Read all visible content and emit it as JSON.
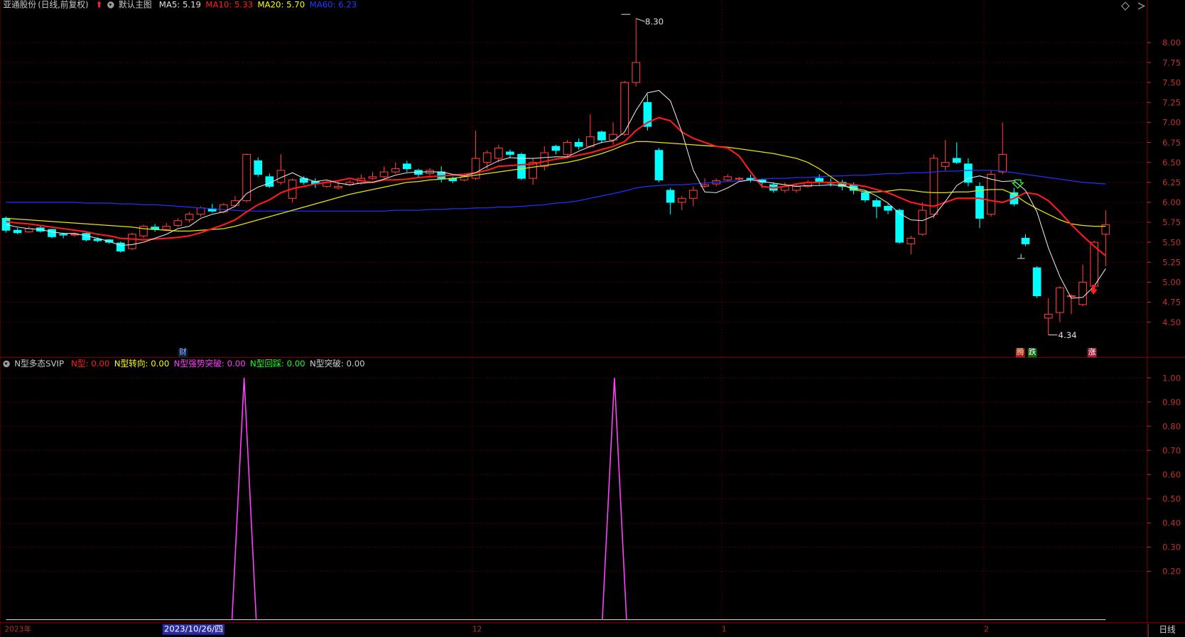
{
  "main_panel": {
    "stock_name": "亚通股份",
    "period_label": "(日线,前复权)",
    "indicator_name": "默认主图",
    "ma_labels": [
      {
        "text": "MA5: 5.19",
        "color": "#e0e0e0"
      },
      {
        "text": "MA10: 5.33",
        "color": "#ff2020"
      },
      {
        "text": "MA20: 5.70",
        "color": "#ffff00"
      },
      {
        "text": "MA60: 6.23",
        "color": "#1f3cff"
      }
    ],
    "high_label": "8.30",
    "low_label": "4.34",
    "tags": {
      "finance": "财",
      "rise_fall_1": "腾",
      "rise_fall_2": "跌",
      "rise": "涨"
    }
  },
  "sub_panel": {
    "title": "N型多态SVIP",
    "items": [
      {
        "text": "N型: 0.00",
        "color": "#ff2020"
      },
      {
        "text": "N型转向: 0.00",
        "color": "#ffff00"
      },
      {
        "text": "N型强势突破: 0.00",
        "color": "#ff40ff"
      },
      {
        "text": "N型回踩: 0.00",
        "color": "#20ff20"
      },
      {
        "text": "N型突破: 0.00",
        "color": "#d0d0d0"
      }
    ]
  },
  "x_axis": {
    "labels": [
      "2023年",
      "12",
      "1",
      "2"
    ],
    "highlighted_date": "2023/10/26/四",
    "period_tab": "日线"
  },
  "colors": {
    "up": "#ff3b3b",
    "down": "#00ffff",
    "ma5": "#e6e6e6",
    "ma10": "#ff1a1a",
    "ma20": "#e6e600",
    "ma60": "#2030ff",
    "indicator": "#ff40ff",
    "grid": "#7a0000"
  },
  "chart_data": [
    {
      "type": "candlestick",
      "ylim": [
        4.2,
        8.4
      ],
      "yticks": [
        "4.50",
        "4.75",
        "5.00",
        "5.25",
        "5.50",
        "5.75",
        "6.00",
        "6.25",
        "6.50",
        "6.75",
        "7.00",
        "7.25",
        "7.50",
        "7.75",
        "8.00"
      ],
      "candles": [
        [
          5.8,
          5.65,
          5.82,
          5.62
        ],
        [
          5.65,
          5.62,
          5.68,
          5.6
        ],
        [
          5.63,
          5.67,
          5.7,
          5.62
        ],
        [
          5.68,
          5.64,
          5.7,
          5.62
        ],
        [
          5.66,
          5.57,
          5.67,
          5.55
        ],
        [
          5.6,
          5.59,
          5.62,
          5.55
        ],
        [
          5.59,
          5.6,
          5.62,
          5.57
        ],
        [
          5.61,
          5.53,
          5.62,
          5.51
        ],
        [
          5.54,
          5.52,
          5.56,
          5.5
        ],
        [
          5.53,
          5.5,
          5.54,
          5.48
        ],
        [
          5.49,
          5.39,
          5.51,
          5.37
        ],
        [
          5.42,
          5.6,
          5.62,
          5.4
        ],
        [
          5.58,
          5.7,
          5.72,
          5.55
        ],
        [
          5.69,
          5.66,
          5.73,
          5.63
        ],
        [
          5.66,
          5.7,
          5.74,
          5.64
        ],
        [
          5.71,
          5.77,
          5.8,
          5.69
        ],
        [
          5.78,
          5.85,
          5.88,
          5.75
        ],
        [
          5.85,
          5.93,
          5.95,
          5.82
        ],
        [
          5.92,
          5.89,
          5.98,
          5.87
        ],
        [
          5.88,
          5.97,
          5.99,
          5.86
        ],
        [
          5.96,
          6.02,
          6.08,
          5.94
        ],
        [
          6.02,
          6.6,
          6.61,
          6.0
        ],
        [
          6.52,
          6.35,
          6.56,
          6.32
        ],
        [
          6.32,
          6.2,
          6.36,
          6.18
        ],
        [
          6.25,
          6.4,
          6.6,
          6.22
        ],
        [
          6.05,
          6.28,
          6.3,
          6.0
        ],
        [
          6.3,
          6.25,
          6.33,
          6.22
        ],
        [
          6.26,
          6.23,
          6.3,
          6.18
        ],
        [
          6.2,
          6.25,
          6.28,
          6.18
        ],
        [
          6.18,
          6.2,
          6.26,
          6.16
        ],
        [
          6.22,
          6.25,
          6.28,
          6.2
        ],
        [
          6.24,
          6.3,
          6.35,
          6.22
        ],
        [
          6.3,
          6.32,
          6.38,
          6.28
        ],
        [
          6.32,
          6.38,
          6.45,
          6.3
        ],
        [
          6.38,
          6.42,
          6.5,
          6.36
        ],
        [
          6.48,
          6.42,
          6.52,
          6.38
        ],
        [
          6.4,
          6.35,
          6.42,
          6.3
        ],
        [
          6.36,
          6.4,
          6.43,
          6.33
        ],
        [
          6.38,
          6.3,
          6.45,
          6.25
        ],
        [
          6.3,
          6.27,
          6.32,
          6.24
        ],
        [
          6.28,
          6.32,
          6.36,
          6.26
        ],
        [
          6.3,
          6.55,
          6.9,
          6.28
        ],
        [
          6.5,
          6.62,
          6.65,
          6.42
        ],
        [
          6.55,
          6.68,
          6.72,
          6.5
        ],
        [
          6.63,
          6.6,
          6.66,
          6.55
        ],
        [
          6.6,
          6.3,
          6.62,
          6.28
        ],
        [
          6.3,
          6.5,
          6.55,
          6.22
        ],
        [
          6.45,
          6.62,
          6.7,
          6.4
        ],
        [
          6.7,
          6.65,
          6.72,
          6.6
        ],
        [
          6.6,
          6.75,
          6.78,
          6.55
        ],
        [
          6.75,
          6.7,
          6.8,
          6.66
        ],
        [
          6.7,
          6.82,
          7.1,
          6.68
        ],
        [
          6.88,
          6.78,
          6.9,
          6.74
        ],
        [
          6.78,
          6.85,
          7.0,
          6.72
        ],
        [
          6.85,
          7.5,
          7.52,
          6.83
        ],
        [
          7.5,
          7.75,
          8.3,
          7.45
        ],
        [
          7.25,
          6.95,
          7.35,
          6.9
        ],
        [
          6.65,
          6.28,
          6.68,
          6.25
        ],
        [
          6.15,
          6.0,
          6.18,
          5.85
        ],
        [
          6.0,
          6.05,
          6.08,
          5.9
        ],
        [
          6.05,
          6.15,
          6.2,
          5.95
        ],
        [
          6.2,
          6.22,
          6.3,
          6.18
        ],
        [
          6.23,
          6.27,
          6.3,
          6.2
        ],
        [
          6.28,
          6.32,
          6.35,
          6.26
        ],
        [
          6.3,
          6.3,
          6.32,
          6.27
        ],
        [
          6.3,
          6.28,
          6.35,
          6.25
        ],
        [
          6.28,
          6.25,
          6.3,
          6.18
        ],
        [
          6.22,
          6.15,
          6.25,
          6.12
        ],
        [
          6.15,
          6.2,
          6.25,
          6.12
        ],
        [
          6.15,
          6.2,
          6.22,
          6.12
        ],
        [
          6.2,
          6.25,
          6.28,
          6.18
        ],
        [
          6.3,
          6.25,
          6.35,
          6.22
        ],
        [
          6.25,
          6.24,
          6.3,
          6.2
        ],
        [
          6.25,
          6.2,
          6.28,
          6.15
        ],
        [
          6.22,
          6.15,
          6.25,
          6.1
        ],
        [
          6.12,
          6.03,
          6.15,
          6.0
        ],
        [
          6.02,
          5.95,
          6.05,
          5.8
        ],
        [
          5.95,
          5.9,
          5.98,
          5.85
        ],
        [
          5.9,
          5.5,
          5.92,
          5.48
        ],
        [
          5.48,
          5.55,
          5.58,
          5.35
        ],
        [
          5.6,
          5.9,
          6.0,
          5.58
        ],
        [
          5.85,
          6.55,
          6.6,
          5.8
        ],
        [
          6.45,
          6.5,
          6.78,
          6.4
        ],
        [
          6.55,
          6.5,
          6.75,
          6.48
        ],
        [
          6.48,
          6.25,
          6.55,
          6.2
        ],
        [
          6.2,
          5.8,
          6.25,
          5.68
        ],
        [
          5.85,
          6.35,
          6.4,
          5.82
        ],
        [
          6.38,
          6.6,
          7.0,
          6.35
        ],
        [
          6.12,
          5.98,
          6.18,
          5.95
        ],
        [
          5.55,
          5.48,
          5.6,
          5.45
        ],
        [
          5.18,
          4.83,
          5.2,
          4.8
        ],
        [
          4.55,
          4.6,
          4.8,
          4.34
        ],
        [
          4.62,
          4.93,
          4.95,
          4.5
        ],
        [
          4.83,
          4.83,
          4.85,
          4.6
        ],
        [
          4.72,
          5.0,
          5.22,
          4.7
        ],
        [
          4.95,
          5.5,
          5.52,
          4.92
        ],
        [
          5.6,
          5.72,
          5.9,
          5.2
        ]
      ],
      "ma5": [
        5.72,
        5.69,
        5.67,
        5.66,
        5.63,
        5.61,
        5.61,
        5.58,
        5.55,
        5.51,
        5.46,
        5.47,
        5.5,
        5.55,
        5.6,
        5.67,
        5.7,
        5.8,
        5.85,
        5.88,
        5.95,
        6.11,
        6.19,
        6.24,
        6.31,
        6.37,
        6.3,
        6.26,
        6.28,
        6.24,
        6.22,
        6.24,
        6.25,
        6.29,
        6.34,
        6.37,
        6.38,
        6.38,
        6.38,
        6.35,
        6.33,
        6.37,
        6.45,
        6.52,
        6.56,
        6.55,
        6.55,
        6.56,
        6.57,
        6.57,
        6.64,
        6.7,
        6.75,
        6.77,
        6.88,
        7.15,
        7.37,
        7.4,
        7.27,
        6.88,
        6.4,
        6.13,
        6.12,
        6.18,
        6.26,
        6.28,
        6.26,
        6.24,
        6.22,
        6.2,
        6.21,
        6.21,
        6.22,
        6.21,
        6.18,
        6.15,
        6.08,
        5.99,
        5.86,
        5.78,
        5.77,
        5.83,
        6.01,
        6.21,
        6.3,
        6.33,
        6.29,
        6.26,
        6.27,
        6.15,
        5.88,
        5.43,
        5.07,
        4.8,
        4.81,
        4.95,
        5.17
      ],
      "ma10": [
        5.76,
        5.74,
        5.73,
        5.71,
        5.69,
        5.67,
        5.65,
        5.63,
        5.6,
        5.58,
        5.55,
        5.54,
        5.53,
        5.54,
        5.55,
        5.56,
        5.58,
        5.62,
        5.67,
        5.72,
        5.78,
        5.88,
        5.97,
        6.03,
        6.12,
        6.17,
        6.2,
        6.23,
        6.25,
        6.27,
        6.3,
        6.27,
        6.25,
        6.28,
        6.28,
        6.29,
        6.31,
        6.32,
        6.33,
        6.34,
        6.35,
        6.37,
        6.4,
        6.45,
        6.46,
        6.47,
        6.48,
        6.51,
        6.54,
        6.56,
        6.59,
        6.62,
        6.66,
        6.7,
        6.76,
        6.9,
        7.0,
        7.06,
        7.02,
        6.88,
        6.8,
        6.75,
        6.7,
        6.68,
        6.58,
        6.38,
        6.2,
        6.18,
        6.2,
        6.23,
        6.25,
        6.25,
        6.25,
        6.24,
        6.22,
        6.2,
        6.16,
        6.12,
        6.06,
        6.0,
        5.97,
        5.95,
        6.0,
        6.05,
        6.05,
        6.05,
        6.02,
        6.0,
        6.05,
        6.12,
        6.1,
        6.02,
        5.88,
        5.72,
        5.58,
        5.45,
        5.33
      ],
      "ma20": [
        5.8,
        5.79,
        5.78,
        5.77,
        5.76,
        5.75,
        5.74,
        5.73,
        5.72,
        5.71,
        5.7,
        5.69,
        5.67,
        5.66,
        5.65,
        5.64,
        5.64,
        5.65,
        5.66,
        5.67,
        5.7,
        5.74,
        5.78,
        5.82,
        5.86,
        5.9,
        5.94,
        5.98,
        6.02,
        6.06,
        6.1,
        6.13,
        6.16,
        6.19,
        6.22,
        6.25,
        6.26,
        6.28,
        6.29,
        6.3,
        6.32,
        6.34,
        6.36,
        6.38,
        6.4,
        6.42,
        6.44,
        6.46,
        6.48,
        6.5,
        6.53,
        6.57,
        6.61,
        6.66,
        6.72,
        6.76,
        6.76,
        6.75,
        6.74,
        6.73,
        6.72,
        6.71,
        6.7,
        6.69,
        6.67,
        6.65,
        6.63,
        6.61,
        6.58,
        6.55,
        6.5,
        6.42,
        6.32,
        6.22,
        6.16,
        6.13,
        6.13,
        6.14,
        6.16,
        6.15,
        6.13,
        6.12,
        6.12,
        6.13,
        6.13,
        6.15,
        6.16,
        6.16,
        6.1,
        6.0,
        5.92,
        5.85,
        5.78,
        5.73,
        5.71,
        5.7,
        5.7
      ],
      "ma60": [
        6.0,
        6.0,
        6.0,
        6.0,
        6.0,
        6.0,
        6.0,
        5.99,
        5.99,
        5.99,
        5.98,
        5.98,
        5.97,
        5.97,
        5.96,
        5.95,
        5.94,
        5.93,
        5.92,
        5.91,
        5.9,
        5.89,
        5.89,
        5.89,
        5.89,
        5.89,
        5.89,
        5.89,
        5.89,
        5.89,
        5.89,
        5.89,
        5.89,
        5.89,
        5.9,
        5.9,
        5.9,
        5.91,
        5.91,
        5.92,
        5.92,
        5.93,
        5.93,
        5.94,
        5.94,
        5.95,
        5.96,
        5.97,
        5.99,
        6.0,
        6.02,
        6.05,
        6.08,
        6.11,
        6.14,
        6.18,
        6.2,
        6.21,
        6.22,
        6.22,
        6.23,
        6.24,
        6.25,
        6.26,
        6.27,
        6.28,
        6.29,
        6.3,
        6.3,
        6.31,
        6.31,
        6.32,
        6.33,
        6.33,
        6.34,
        6.34,
        6.35,
        6.36,
        6.36,
        6.37,
        6.37,
        6.38,
        6.39,
        6.39,
        6.4,
        6.4,
        6.4,
        6.39,
        6.37,
        6.35,
        6.33,
        6.31,
        6.29,
        6.27,
        6.25,
        6.24,
        6.23
      ]
    },
    {
      "type": "line",
      "name": "N型强势突破",
      "ylim": [
        0,
        1.05
      ],
      "yticks": [
        "0.20",
        "0.30",
        "0.40",
        "0.50",
        "0.60",
        "0.70",
        "0.80",
        "0.90",
        "1.00"
      ],
      "spikes_at_index": [
        20,
        51
      ],
      "values_note_zero_else": 0
    }
  ]
}
